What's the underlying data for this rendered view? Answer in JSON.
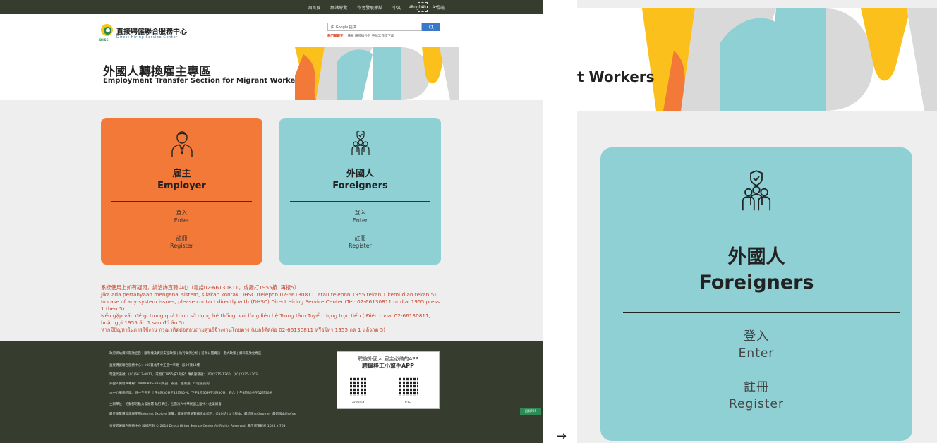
{
  "topbar": {
    "links": [
      "回首頁",
      "網站導覽",
      "作者發展聯結",
      "中文",
      "English",
      "雲端"
    ],
    "font_sizes": [
      "A-",
      "A",
      "A+"
    ]
  },
  "header": {
    "site_title": "直接聘僱聯合服務中心",
    "site_title_en": "Direct Hiring Service Center",
    "logo_sub": "DHSC",
    "search_placeholder": "由 Google 提供",
    "search_button": "🔍",
    "hot_label": "熱門關鍵字",
    "hot_keywords": "： 備轉 驗證碼外勞 申請工作證下載"
  },
  "banner": {
    "title": "外國人轉換雇主專區",
    "subtitle": "Employment Transfer Section for Migrant Workers"
  },
  "cards": {
    "employer": {
      "zh": "雇主",
      "en": "Employer",
      "enter_zh": "登入",
      "enter_en": "Enter",
      "register_zh": "註冊",
      "register_en": "Register"
    },
    "foreigners": {
      "zh": "外國人",
      "en": "Foreigners",
      "enter_zh": "登入",
      "enter_en": "Enter",
      "register_zh": "註冊",
      "register_en": "Register"
    }
  },
  "notice": [
    "系統使用上如有疑問，請洽詢直聘中心（電話02-66130811，或撥打1955按1再按5）",
    "Jika ada pertanyaan mengenai sistem, silakan kontak DHSC (telepon 02-66130811, atau telepon 1955 tekan 1 kemudian tekan 5)",
    "In case of any system issues, please contact directly with (DHSC) Direct Hiring Service Center (Tel: 02-66130811 or dial 1955 press 1 then 5)",
    "Nếu gặp vấn đề gì trong quá trình sử dụng hệ thống, vui lòng liên hệ Trung tâm Tuyển dụng trực tiếp ( Điện thoại 02-66130811, hoặc gọi 1955 ấn 1 sau đó ấn 5)",
    "หากมีปัญหาในการใช้งาน กรุณาติดต่อสอบถามศูนย์จ้างงานโดยตรง (เบอร์ติดต่อ 02-66130811 หรือโทร 1955 กด 1 แล้วกด 5)"
  ],
  "footer": {
    "lines": [
      "政府網站資料開放宣告 | 隱私權及資訊安全政策 | 執行案例分析 | 首頁公開資訊 | 重大政策 | 資料開放化專區",
      "直接聘僱聯合服務中心：100臺北市中正區中華路一段39號13樓",
      "電話代表號：(02)6613-0811，或撥打1955按1再按5 傳真服務號：(02)2375-1360、(02)2375-1363",
      "外國人免付費專線：0800-885-885(英語、泰語、越南語、印尼語諮詢)",
      "本中心服務時間：週一至週五  上午8時30分至12時30分，下午1時30分至5時30分；週六  上午8時30分至12時30分",
      "主辦單位：勞動部勞動力發展署    執行單位：社團法人中華民國全國中小企業總會",
      "最佳瀏覽環境建議使用Internet Explorer瀏覽，建議使用瀏覽器版本如下：IE10(含)以上版本，最新版本Chrome，最新版本Firefox",
      "直接聘僱聯合服務中心 版權所有 © 2018 Direct Hiring Service Center All Rights Reserved. 最佳瀏覽解析 1024 x 768"
    ],
    "app_title1": "聘僱外國人  雇主必備的APP",
    "app_title2": "聘僱移工小幫手APP",
    "android_label": "Android",
    "ios_label": "IOS",
    "gotop": "回到TOP"
  },
  "zoom": {
    "banner_text": "t Workers",
    "arrow": "→"
  },
  "colors": {
    "employer_card": "#f27938",
    "foreigners_card": "#8ed0d4",
    "footer_bg": "#363c2e",
    "notice_text": "#c9432a",
    "art_yellow": "#fcc01c",
    "art_orange": "#f27938",
    "art_teal": "#8ed0d4",
    "art_gray": "#d9d9d9"
  }
}
